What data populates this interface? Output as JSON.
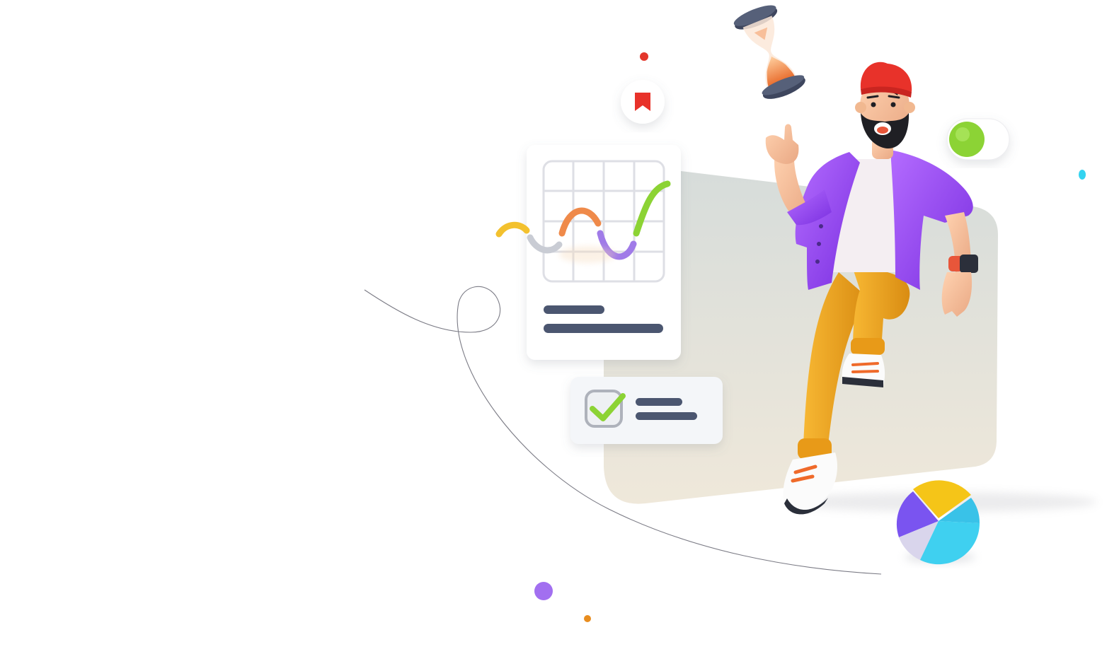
{
  "illustration": {
    "subject": "3d-character-with-productivity-icons",
    "icons": [
      "hourglass-icon",
      "bookmark-icon",
      "toggle-switch-icon",
      "line-chart-card-icon",
      "checkbox-card-icon",
      "pie-chart-icon"
    ],
    "colors": {
      "panel_top": "#d8ddda",
      "panel_bottom": "#eee7d8",
      "purple": "#9a4bf0",
      "mustard": "#f0a821",
      "red": "#e8322a",
      "green": "#8cd334",
      "navy": "#4b5670",
      "cyan": "#3fd0f0",
      "chart_yellow": "#f3c12e",
      "chart_orange": "#ef8a4a",
      "chart_purple": "#a07be8",
      "chart_grey": "#c9ccd4"
    }
  }
}
